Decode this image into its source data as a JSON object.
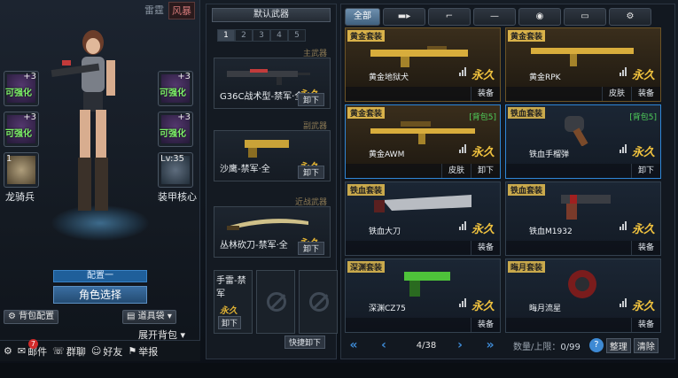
{
  "mode_tabs": [
    "雷霆",
    "风暴"
  ],
  "slots": {
    "left_top": {
      "plus": "+3",
      "tag": "可强化"
    },
    "left_mid": {
      "plus": "+3",
      "tag": "可强化"
    },
    "right_top": {
      "plus": "+3",
      "tag": "可强化"
    },
    "right_mid": {
      "plus": "+3",
      "tag": "可强化"
    },
    "left_bottom": {
      "level": "1",
      "label": "龙骑兵"
    },
    "right_bottom": {
      "level": "Lv:35",
      "label": "装甲核心"
    }
  },
  "character": {
    "config_label": "配置一",
    "role_select": "角色选择",
    "backpack_config": "背包配置",
    "item_bag": "道具袋",
    "expand_bag": "展开背包"
  },
  "bottom_bar": {
    "mail": "邮件",
    "mail_badge": "7",
    "group": "群聊",
    "friends": "好友",
    "report": "举报"
  },
  "equip": {
    "title": "默认武器",
    "num_tabs": [
      "1",
      "2",
      "3",
      "4",
      "5"
    ],
    "primary_label": "主武器",
    "secondary_label": "副武器",
    "melee_label": "近战武器",
    "primary_name": "G36C战术型-禁军·全",
    "secondary_name": "沙鹰-禁军·全",
    "melee_name": "丛林砍刀-禁军·全",
    "perm": "永久",
    "unload": "卸下",
    "grenade_name": "手雷-禁军",
    "quick_unload": "快捷卸下"
  },
  "filters": [
    "全部"
  ],
  "inventory": [
    {
      "type": "黄金套装",
      "name": "黄金地狱犬",
      "perm": "永久",
      "actions": [
        "装备"
      ],
      "gold": true
    },
    {
      "type": "黄金套装",
      "name": "黄金RPK",
      "perm": "永久",
      "actions": [
        "皮肤",
        "装备"
      ],
      "gold": true
    },
    {
      "type": "黄金套装",
      "name": "黄金AWM",
      "perm": "永久",
      "pack": "[背包5]",
      "actions": [
        "皮肤",
        "卸下"
      ],
      "gold": true
    },
    {
      "type": "铁血套装",
      "name": "铁血手榴弹",
      "perm": "永久",
      "pack": "[背包5]",
      "actions": [
        "卸下"
      ],
      "gold": false
    },
    {
      "type": "铁血套装",
      "name": "铁血大刀",
      "perm": "永久",
      "actions": [
        "装备"
      ],
      "gold": false
    },
    {
      "type": "铁血套装",
      "name": "铁血M1932",
      "perm": "永久",
      "actions": [
        "装备"
      ],
      "gold": false
    },
    {
      "type": "深渊套装",
      "name": "深渊CZ75",
      "perm": "永久",
      "actions": [
        "装备"
      ],
      "gold": false
    },
    {
      "type": "晦月套装",
      "name": "晦月流星",
      "perm": "永久",
      "actions": [
        "装备"
      ],
      "gold": false
    }
  ],
  "pager": {
    "page": "4/38",
    "count_label": "数量/上限：",
    "count_value": "0/99",
    "help": "?",
    "sort": "整理",
    "clear": "清除"
  }
}
